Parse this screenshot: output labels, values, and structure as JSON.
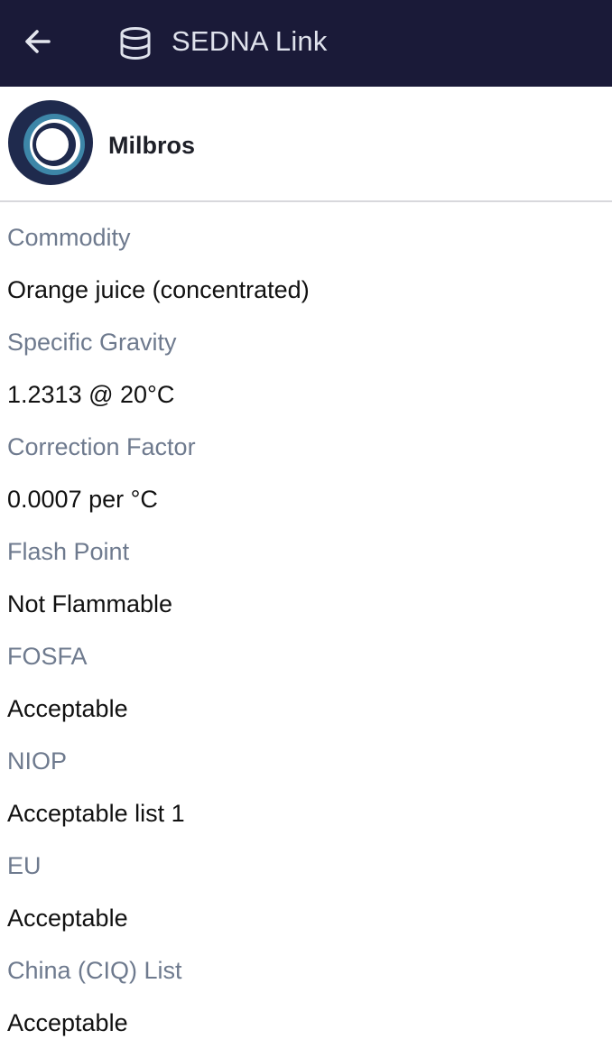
{
  "header": {
    "title": "SEDNA Link",
    "back_icon": "arrow-left-icon",
    "app_icon": "database-icon",
    "background_color": "#1a1a38"
  },
  "company": {
    "name": "Milbros",
    "logo_icon": "company-logo"
  },
  "fields": [
    {
      "label": "Commodity",
      "value": "Orange juice (concentrated)"
    },
    {
      "label": "Specific Gravity",
      "value": "1.2313 @ 20°C"
    },
    {
      "label": "Correction Factor",
      "value": "0.0007 per °C"
    },
    {
      "label": "Flash Point",
      "value": "Not Flammable"
    },
    {
      "label": "FOSFA",
      "value": "Acceptable"
    },
    {
      "label": "NIOP",
      "value": "Acceptable list 1"
    },
    {
      "label": "EU",
      "value": "Acceptable"
    },
    {
      "label": "China (CIQ) List",
      "value": "Acceptable"
    }
  ]
}
